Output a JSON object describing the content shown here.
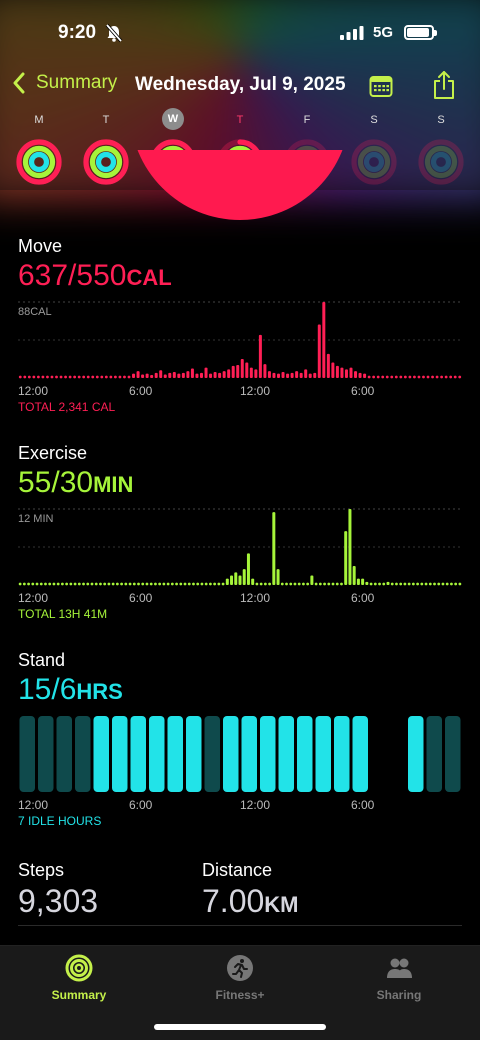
{
  "status": {
    "time": "9:20",
    "network": "5G"
  },
  "nav": {
    "back_label": "Summary",
    "title": "Wednesday, Jul 9, 2025"
  },
  "week": [
    {
      "letter": "M",
      "move": 1.0,
      "exercise": 1.0,
      "stand": 1.0,
      "state": "past"
    },
    {
      "letter": "T",
      "move": 1.0,
      "exercise": 1.0,
      "stand": 1.0,
      "state": "past"
    },
    {
      "letter": "W",
      "move": 1.0,
      "exercise": 1.0,
      "stand": 1.0,
      "state": "today"
    },
    {
      "letter": "T",
      "move": 0.8,
      "exercise": 1.0,
      "stand": 1.0,
      "state": "current"
    },
    {
      "letter": "F",
      "move": 0,
      "exercise": 0,
      "stand": 0,
      "state": "future"
    },
    {
      "letter": "S",
      "move": 0,
      "exercise": 0,
      "stand": 0,
      "state": "future"
    },
    {
      "letter": "S",
      "move": 0,
      "exercise": 0,
      "stand": 0,
      "state": "future"
    }
  ],
  "colors": {
    "move": "#ff1f55",
    "exercise": "#a6f43a",
    "stand": "#22e3e8",
    "accent": "#c4f04a"
  },
  "move": {
    "label": "Move",
    "value": "637/550",
    "unit": "CAL",
    "chart_max": "88CAL",
    "total": "TOTAL 2,341 CAL",
    "ticks": [
      "12:00",
      "6:00",
      "12:00",
      "6:00"
    ],
    "bars": [
      0,
      0,
      0,
      0,
      0,
      0,
      0,
      0,
      0,
      0,
      0,
      0,
      0,
      0,
      0,
      0,
      0,
      0,
      0,
      0,
      0,
      0,
      0,
      0,
      0,
      5,
      8,
      4,
      5,
      3,
      6,
      9,
      4,
      6,
      7,
      5,
      6,
      8,
      11,
      5,
      6,
      12,
      5,
      7,
      6,
      8,
      10,
      14,
      15,
      22,
      18,
      12,
      10,
      50,
      16,
      8,
      6,
      5,
      7,
      5,
      6,
      8,
      6,
      10,
      5,
      6,
      62,
      88,
      28,
      18,
      14,
      12,
      10,
      12,
      8,
      6,
      5,
      0,
      0,
      0,
      0,
      0,
      0,
      0,
      0,
      0,
      0,
      0,
      0,
      0,
      0,
      0,
      0,
      0,
      0,
      0,
      0,
      0
    ]
  },
  "exercise": {
    "label": "Exercise",
    "value": "55/30",
    "unit": "MIN",
    "chart_max": "12 MIN",
    "total": "TOTAL 13H 41M",
    "ticks": [
      "12:00",
      "6:00",
      "12:00",
      "6:00"
    ],
    "bars": [
      0,
      0,
      0,
      0,
      0,
      0,
      0,
      0,
      0,
      0,
      0,
      0,
      0,
      0,
      0,
      0,
      0,
      0,
      0,
      0,
      0,
      0,
      0,
      0,
      0,
      0,
      0,
      0,
      0,
      0,
      0,
      0,
      0,
      0,
      0,
      0,
      0,
      0,
      0,
      0,
      0,
      0,
      0,
      0,
      0,
      0,
      0,
      0,
      0,
      1,
      1.5,
      2,
      1.5,
      2.5,
      5,
      1,
      0,
      0,
      0,
      0,
      11.5,
      2.5,
      0,
      0,
      0,
      0,
      0,
      0,
      0,
      1.5,
      0,
      0,
      0,
      0,
      0,
      0,
      0,
      8.5,
      12,
      3,
      1,
      1,
      0.5,
      0,
      0,
      0,
      0,
      0.5,
      0,
      0,
      0,
      0,
      0,
      0,
      0,
      0,
      0,
      0,
      0,
      0,
      0,
      0,
      0,
      0,
      0
    ]
  },
  "stand": {
    "label": "Stand",
    "value": "15/6",
    "unit": "HRS",
    "total": "7 IDLE HOURS",
    "ticks": [
      "12:00",
      "6:00",
      "12:00",
      "6:00"
    ],
    "hours": [
      0,
      0,
      0,
      0,
      1,
      1,
      1,
      1,
      1,
      1,
      0,
      1,
      1,
      1,
      1,
      1,
      1,
      1,
      1,
      -1,
      -1,
      1,
      0,
      0
    ]
  },
  "steps": {
    "label": "Steps",
    "value": "9,303"
  },
  "distance": {
    "label": "Distance",
    "value": "7.00",
    "unit": "KM"
  },
  "tabs": [
    {
      "label": "Summary",
      "icon": "activity-rings-icon",
      "active": true
    },
    {
      "label": "Fitness+",
      "icon": "runner-icon",
      "active": false
    },
    {
      "label": "Sharing",
      "icon": "people-icon",
      "active": false
    }
  ]
}
